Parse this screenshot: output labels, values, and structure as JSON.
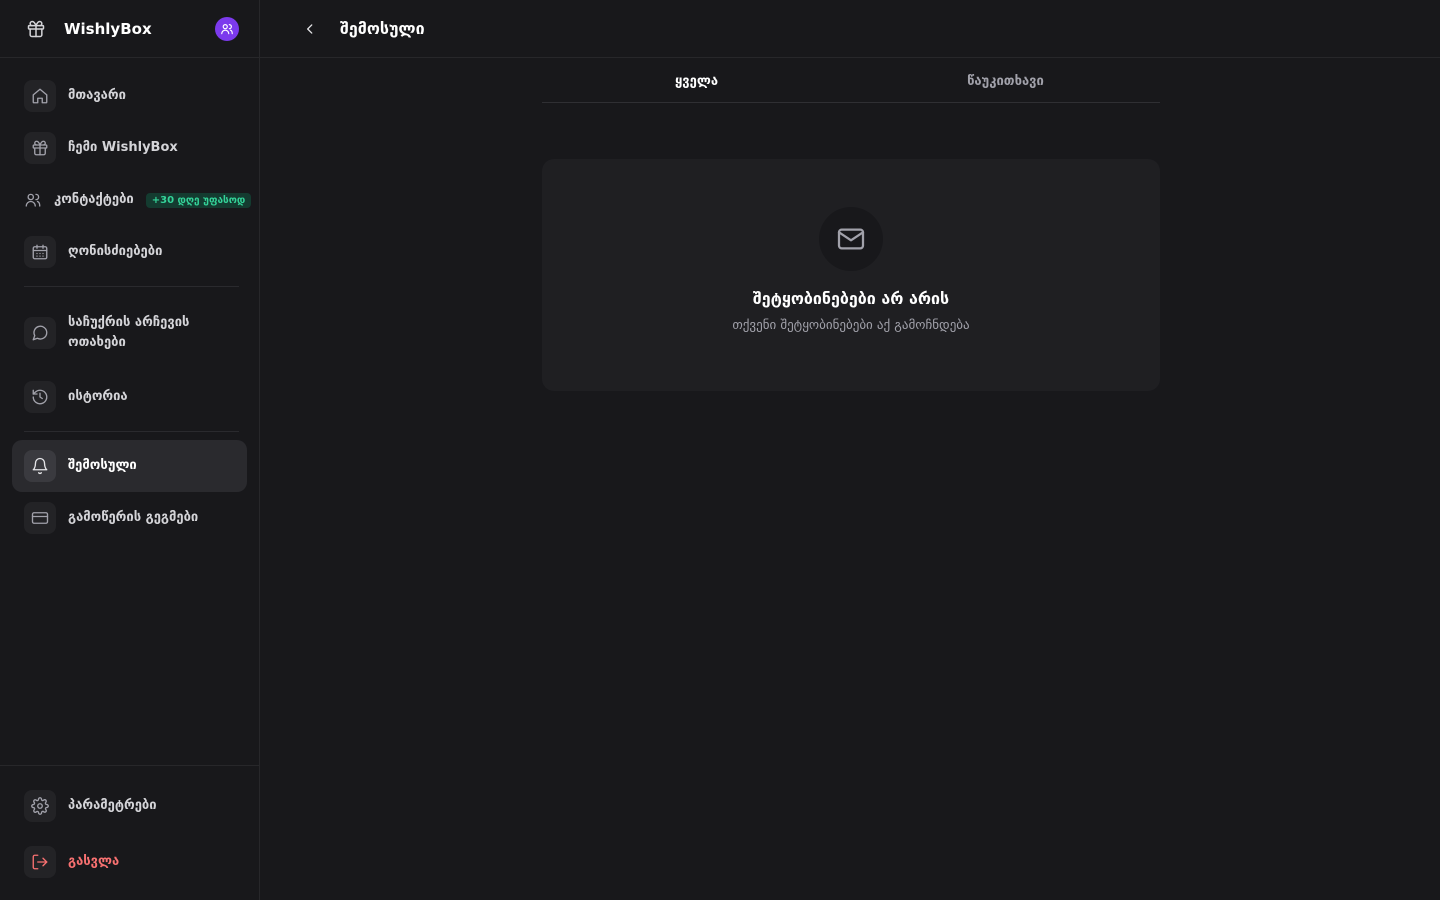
{
  "sidebar": {
    "brand": "WishlyBox",
    "items": [
      {
        "label": "მთავარი",
        "icon": "home-icon"
      },
      {
        "label": "ჩემი WishlyBox",
        "icon": "gift-icon"
      },
      {
        "label": "კონტაქტები",
        "icon": "users-icon",
        "badge": "+30 დღე უფასოდ"
      },
      {
        "label": "ღონისძიებები",
        "icon": "calendar-icon"
      },
      {
        "label": "საჩუქრის არჩევის ოთახები",
        "icon": "chat-icon"
      },
      {
        "label": "ისტორია",
        "icon": "history-icon"
      },
      {
        "label": "შემოსული",
        "icon": "bell-icon",
        "active": true
      },
      {
        "label": "გამოწერის გეგმები",
        "icon": "card-icon"
      }
    ],
    "bottom": [
      {
        "label": "პარამეტრები",
        "icon": "gear-icon"
      },
      {
        "label": "გასვლა",
        "icon": "logout-icon"
      }
    ]
  },
  "header": {
    "title": "შემოსული"
  },
  "tabs": [
    {
      "label": "ყველა",
      "active": true
    },
    {
      "label": "წაუკითხავი",
      "active": false
    }
  ],
  "empty_state": {
    "title": "შეტყობინებები არ არის",
    "subtitle": "თქვენი შეტყობინებები აქ გამოჩნდება",
    "icon": "mail-icon"
  },
  "colors": {
    "background": "#18181b",
    "accent": "#7c3aed",
    "badge_text": "#34d399",
    "logout": "#f87171"
  }
}
